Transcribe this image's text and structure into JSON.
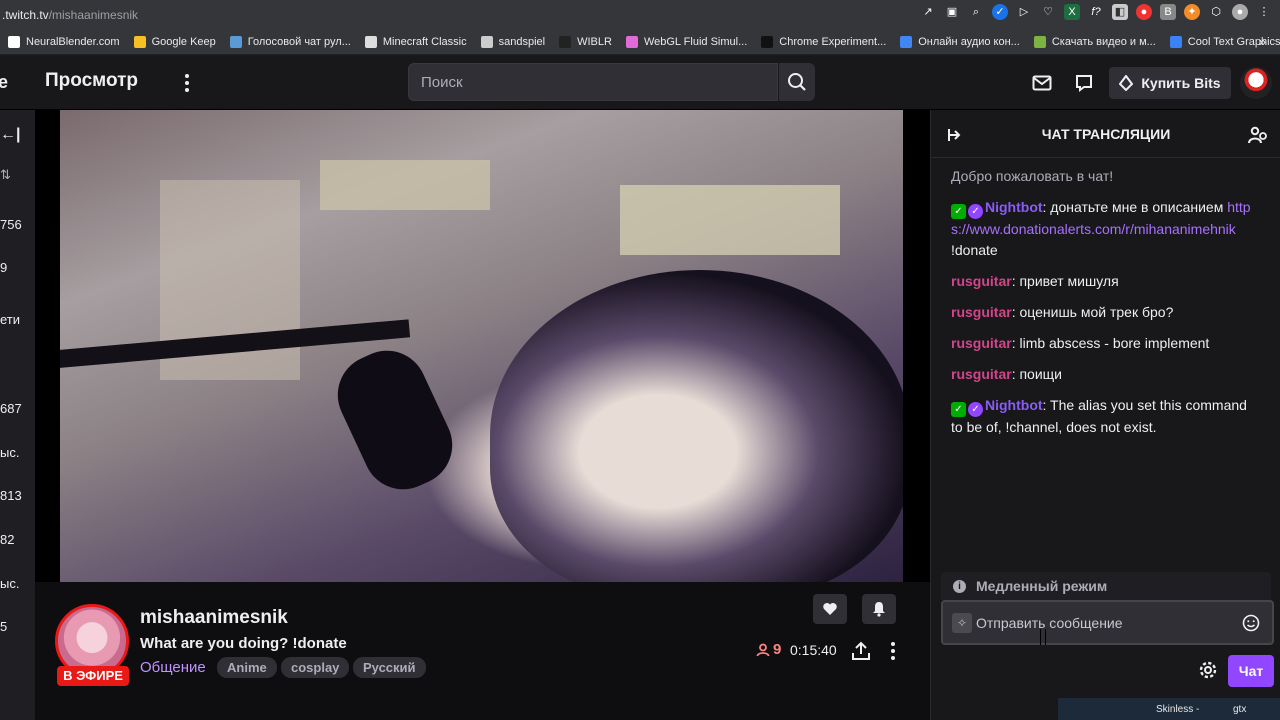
{
  "browser": {
    "url_host": ".twitch.tv",
    "url_path": "/mishaanimesnik",
    "bookmarks": [
      {
        "label": "NeuralBlender.com",
        "color": "#ffffff"
      },
      {
        "label": "Google Keep",
        "color": "#f6bf26"
      },
      {
        "label": "Голосовой чат рул...",
        "color": "#5b9bd5"
      },
      {
        "label": "Minecraft Classic",
        "color": "#dddddd"
      },
      {
        "label": "sandspiel",
        "color": "#cccccc"
      },
      {
        "label": "WIBLR",
        "color": "#222222"
      },
      {
        "label": "WebGL Fluid Simul...",
        "color": "#e06bd8"
      },
      {
        "label": "Chrome Experiment...",
        "color": "#111111"
      },
      {
        "label": "Онлайн аудио кон...",
        "color": "#4285f4"
      },
      {
        "label": "Скачать видео и м...",
        "color": "#7cb342"
      },
      {
        "label": "Cool Text Graphics...",
        "color": "#3b82f6"
      }
    ]
  },
  "nav": {
    "partial_left": "e",
    "title": "Просмотр",
    "search_placeholder": "Поиск",
    "bits_label": "Купить Bits"
  },
  "leftbar": {
    "items": [
      "←|",
      "⇅",
      "756",
      "9",
      "ети",
      "687",
      "ыс.",
      "813",
      "82",
      "ыс.",
      "5"
    ]
  },
  "stream": {
    "streamer": "mishaanimesnik",
    "title": "What are you doing? !donate",
    "category": "Общение",
    "tags": [
      "Anime",
      "cosplay",
      "Русский"
    ],
    "live_label": "В ЭФИРЕ",
    "viewers": "9",
    "uptime": "0:15:40"
  },
  "chat": {
    "header": "ЧАТ ТРАНСЛЯЦИИ",
    "welcome": "Добро пожаловать в чат!",
    "messages": [
      {
        "user": "Nightbot",
        "text_before": ": донатьте мне в описанием ",
        "link": "https://www.donationalerts.com/r/mihananimehnik",
        "text_after": " !donate"
      },
      {
        "user": "rusguitar",
        "text": ": привет мишуля"
      },
      {
        "user": "rusguitar",
        "text": ": оценишь мой трек бро?"
      },
      {
        "user": "rusguitar",
        "text": ": limb abscess - bore implement"
      },
      {
        "user": "rusguitar",
        "text": ": поищи"
      },
      {
        "user": "Nightbot",
        "text": ": The alias you set this command to be of, !channel, does not exist."
      }
    ],
    "slow_mode": "Медленный режим",
    "input_placeholder": "Отправить сообщение",
    "chat_button": "Чат"
  },
  "taskbar": {
    "items": [
      "Skinless -",
      "gtx"
    ]
  },
  "colors": {
    "accent": "#9147ff",
    "live": "#e91916",
    "nightbot": "#8a5cf6",
    "rusguitar": "#d2458a"
  }
}
